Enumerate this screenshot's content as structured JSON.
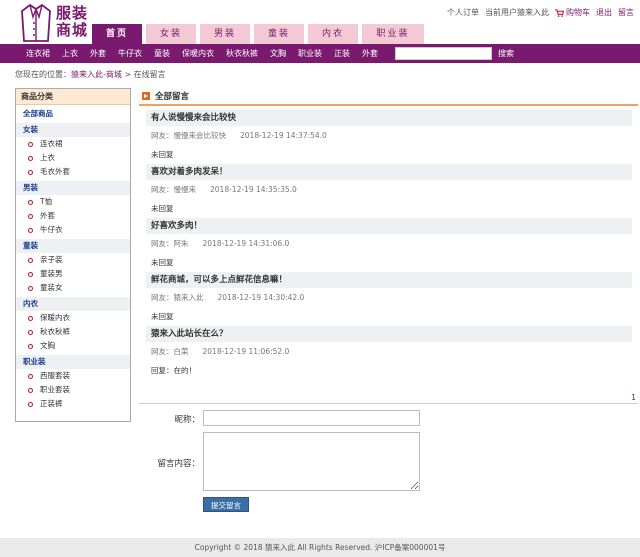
{
  "logo": {
    "text_line1": "服装",
    "text_line2": "商城",
    "icon": "coat-logo"
  },
  "nav": {
    "tabs": [
      "首页",
      "女装",
      "男装",
      "童装",
      "内衣",
      "职业装"
    ],
    "active": 0
  },
  "toplinks": {
    "orders": "个人订单",
    "current_user": "当前用户猿来入此",
    "cart": "购物车",
    "logout": "退出",
    "message": "留言",
    "cart_icon": "cart-icon"
  },
  "category_bar": {
    "items": [
      "连衣裙",
      "上衣",
      "外套",
      "牛仔衣",
      "童装",
      "保暖内衣",
      "秋衣秋裤",
      "文胸",
      "职业装",
      "正装",
      "外套"
    ],
    "search_placeholder": "",
    "search_label": "搜索"
  },
  "breadcrumb": {
    "prefix": "您现在的位置：",
    "home": "猿来入此-商城",
    "sep": ">",
    "current": "在线留言"
  },
  "sidebar": {
    "title": "商品分类",
    "all": "全部商品",
    "groups": [
      {
        "name": "女装",
        "items": [
          "连衣裙",
          "上衣",
          "毛衣外套"
        ]
      },
      {
        "name": "男装",
        "items": [
          "T恤",
          "外套",
          "牛仔衣"
        ]
      },
      {
        "name": "童装",
        "items": [
          "亲子装",
          "童装男",
          "童装女"
        ]
      },
      {
        "name": "内衣",
        "items": [
          "保暖内衣",
          "秋衣秋裤",
          "文胸"
        ]
      },
      {
        "name": "职业装",
        "items": [
          "西服套装",
          "职业套装",
          "正装裤"
        ]
      }
    ]
  },
  "main": {
    "title": "全部留言",
    "messages": [
      {
        "title": "有人说慢慢来会比较快",
        "author": "网友：慢慢来会比较快",
        "time": "2018-12-19 14:37:54.0",
        "reply": "未回复"
      },
      {
        "title": "喜欢对着多肉发呆！",
        "author": "网友：慢慢来",
        "time": "2018-12-19 14:35:35.0",
        "reply": "未回复"
      },
      {
        "title": "好喜欢多肉！",
        "author": "网友：阿朱",
        "time": "2018-12-19 14:31:06.0",
        "reply": "未回复"
      },
      {
        "title": "鲜花商城，可以多上点鲜花信息嘛！",
        "author": "网友：猿来入此",
        "time": "2018-12-19 14:30:42.0",
        "reply": "未回复"
      },
      {
        "title": "猿来入此站长在么？",
        "author": "网友：白菜",
        "time": "2018-12-19 11:06:52.0",
        "reply": "回复：在的！"
      }
    ],
    "pager": "1"
  },
  "form": {
    "nickname_label": "昵称：",
    "nickname_value": "",
    "content_label": "留言内容：",
    "content_value": "",
    "submit": "提交留言"
  },
  "footer": {
    "text": "Copyright © 2018 猿来入此 All Rights Reserved. 沪ICP备案000001号"
  },
  "colors": {
    "brand": "#7a1a6e",
    "tab_inactive": "#f3c9d3",
    "accent": "#e06a1a",
    "link": "#1a3e8e"
  }
}
